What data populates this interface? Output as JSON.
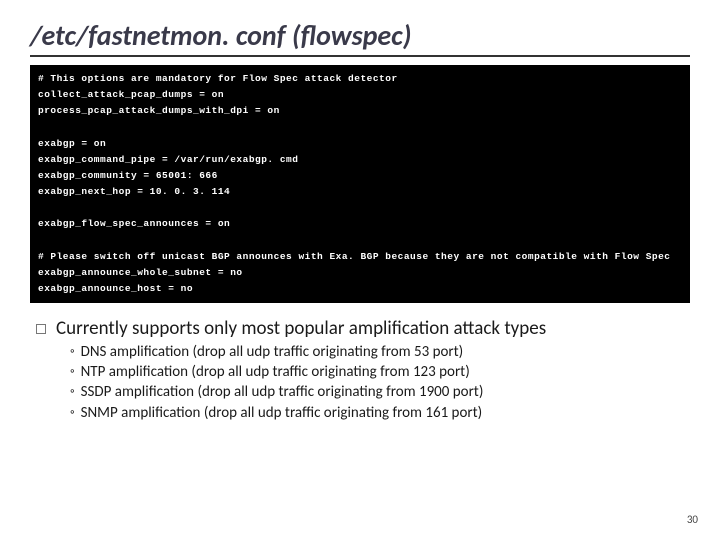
{
  "title": "/etc/fastnetmon. conf (flowspec)",
  "code": {
    "l01": "# This options are mandatory for Flow Spec attack detector",
    "l02": "collect_attack_pcap_dumps = on",
    "l03": "process_pcap_attack_dumps_with_dpi = on",
    "l04": "",
    "l05": "exabgp = on",
    "l06": "exabgp_command_pipe = /var/run/exabgp. cmd",
    "l07": "exabgp_community = 65001: 666",
    "l08": "exabgp_next_hop = 10. 0. 3. 114",
    "l09": "",
    "l10": "exabgp_flow_spec_announces = on",
    "l11": "",
    "l12": "# Please switch off unicast BGP announces with Exa. BGP because they are not compatible with Flow Spec",
    "l13": "exabgp_announce_whole_subnet = no",
    "l14": "exabgp_announce_host = no"
  },
  "bullet": {
    "main": "Currently supports only most popular amplification attack types",
    "items": [
      "DNS amplification (drop all udp traffic originating from 53 port)",
      "NTP amplification (drop all udp traffic originating from 123 port)",
      "SSDP amplification (drop all udp traffic originating from 1900 port)",
      "SNMP amplification (drop all udp traffic originating from 161 port)"
    ]
  },
  "page_number": "30"
}
